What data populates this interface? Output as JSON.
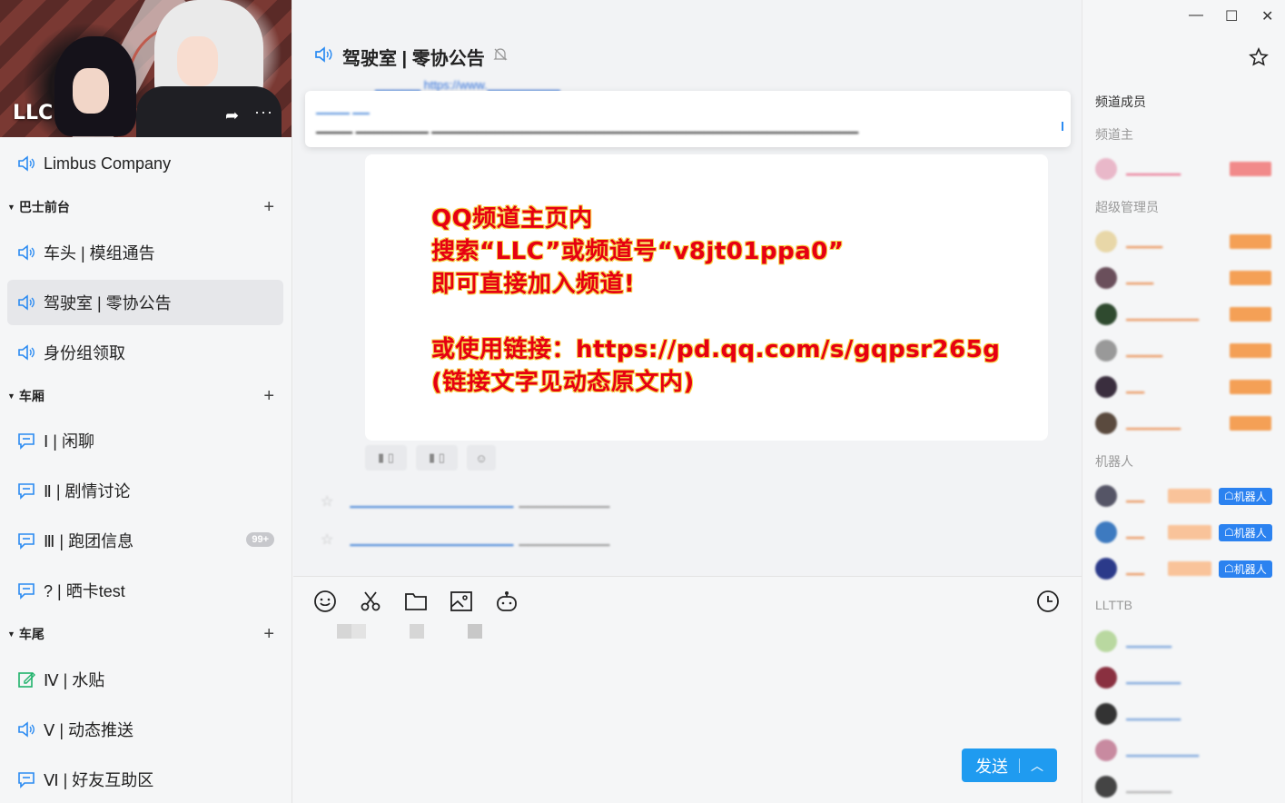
{
  "banner": {
    "title": "LLC",
    "share_icon": "share-icon",
    "more_label": "···"
  },
  "channels_top": [
    {
      "label": "Limbus Company",
      "icon": "speaker-icon"
    }
  ],
  "groups": [
    {
      "label": "巴士前台",
      "channels": [
        {
          "label": "车头 | 模组通告",
          "icon": "speaker-icon"
        },
        {
          "label": "驾驶室 | 零协公告",
          "icon": "speaker-icon",
          "active": true
        },
        {
          "label": "身份组领取",
          "icon": "speaker-icon"
        }
      ]
    },
    {
      "label": "车厢",
      "channels": [
        {
          "label": "Ⅰ | 闲聊",
          "icon": "chat-icon"
        },
        {
          "label": "Ⅱ | 剧情讨论",
          "icon": "chat-icon"
        },
        {
          "label": "Ⅲ | 跑团信息",
          "icon": "chat-icon",
          "badge": "99+"
        },
        {
          "label": "? | 晒卡test",
          "icon": "chat-icon"
        }
      ]
    },
    {
      "label": "车尾",
      "channels": [
        {
          "label": "Ⅳ | 水贴",
          "icon": "note-icon"
        },
        {
          "label": "Ⅴ | 动态推送",
          "icon": "speaker-icon"
        },
        {
          "label": "Ⅵ | 好友互助区",
          "icon": "chat-icon"
        }
      ]
    }
  ],
  "header": {
    "title": "驾驶室 | 零协公告"
  },
  "message": {
    "lines": [
      "QQ频道主页内",
      "搜索“LLC”或频道号“v8jt01ppa0”",
      "即可直接加入频道!",
      "",
      "或使用链接：https://pd.qq.com/s/gqpsr265g",
      "(链接文字见动态原文内)"
    ]
  },
  "members": {
    "title": "频道成员",
    "sections": {
      "owner": "频道主",
      "admins": "超级管理员",
      "bots": "机器人",
      "role": "LLTTB"
    },
    "robot_label": "机器人"
  },
  "colors": {
    "accent": "#1f9bf0",
    "message_text": "#e60012",
    "message_outline": "#f7d34a",
    "robot_tag": "#2b82f0"
  }
}
